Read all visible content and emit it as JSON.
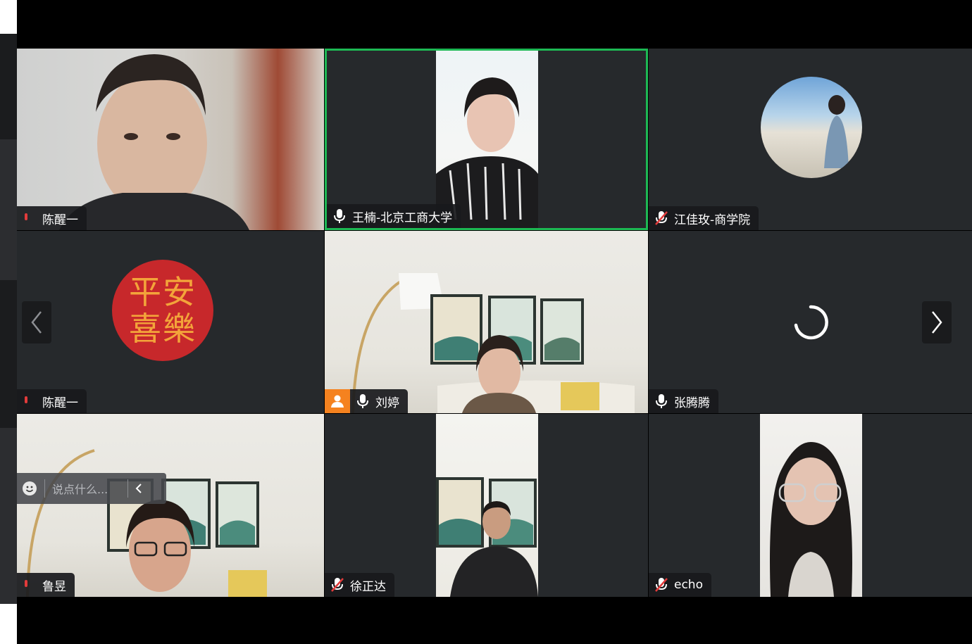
{
  "participants": [
    {
      "name": "陈醒一",
      "mic": "partial",
      "type": "video"
    },
    {
      "name": "王楠-北京工商大学",
      "mic": "on",
      "type": "video",
      "active": true
    },
    {
      "name": "江佳玫-商学院",
      "mic": "muted",
      "type": "avatar"
    },
    {
      "name": "陈醒一",
      "mic": "partial",
      "type": "avatar-text",
      "avatar_text": [
        "平安",
        "喜樂"
      ]
    },
    {
      "name": "刘婷",
      "mic": "on",
      "type": "video",
      "host": true
    },
    {
      "name": "张腾腾",
      "mic": "on",
      "type": "loading"
    },
    {
      "name": "鲁昱",
      "mic": "partial",
      "type": "video"
    },
    {
      "name": "徐正达",
      "mic": "muted",
      "type": "video"
    },
    {
      "name": "echo",
      "mic": "muted",
      "type": "video"
    }
  ],
  "chat": {
    "placeholder": "说点什么..."
  },
  "icons": {
    "mic": "microphone-icon",
    "mic_muted": "microphone-muted-icon",
    "host": "host-person-icon",
    "emoji": "smiley-icon",
    "collapse": "chevron-left-icon",
    "prev": "chevron-left-icon",
    "next": "chevron-right-icon",
    "loading": "loading-spinner-icon"
  },
  "colors": {
    "active_border": "#1db954",
    "host_badge": "#f5821f",
    "tile_bg": "#26292c",
    "muted_red": "#e23b3b",
    "avatar_red": "#c7282b",
    "avatar_text_gold": "#f3a43a"
  }
}
